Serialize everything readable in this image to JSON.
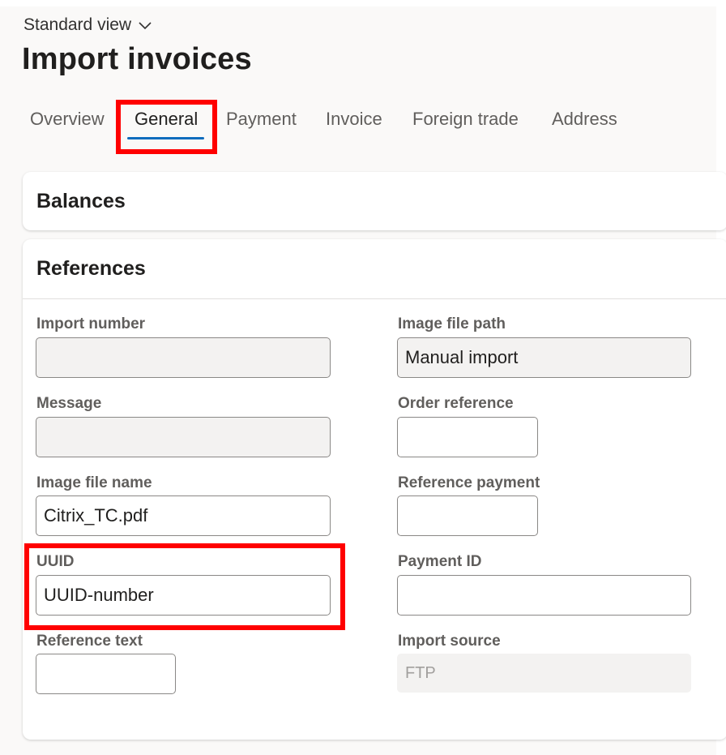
{
  "header": {
    "view_selector": "Standard view",
    "title": "Import invoices"
  },
  "tabs": [
    {
      "label": "Overview"
    },
    {
      "label": "General",
      "active": true
    },
    {
      "label": "Payment"
    },
    {
      "label": "Invoice"
    },
    {
      "label": "Foreign trade"
    },
    {
      "label": "Address"
    }
  ],
  "sections": {
    "balances": {
      "title": "Balances"
    },
    "references": {
      "title": "References",
      "fields": {
        "import_number": {
          "label": "Import number",
          "value": ""
        },
        "image_file_path": {
          "label": "Image file path",
          "value": "Manual import"
        },
        "message": {
          "label": "Message",
          "value": ""
        },
        "order_reference": {
          "label": "Order reference",
          "value": ""
        },
        "image_file_name": {
          "label": "Image file name",
          "value": "Citrix_TC.pdf"
        },
        "reference_payment": {
          "label": "Reference payment",
          "value": ""
        },
        "uuid": {
          "label": "UUID",
          "value": "UUID-number"
        },
        "payment_id": {
          "label": "Payment ID",
          "value": ""
        },
        "reference_text": {
          "label": "Reference text",
          "value": ""
        },
        "import_source": {
          "label": "Import source",
          "value": "FTP"
        }
      }
    }
  },
  "colors": {
    "highlight": "#ff0000",
    "tab_active_underline": "#0f6cbd",
    "readonly_field_bg": "#f3f2f1"
  },
  "icons": {
    "view_selector": "chevron-down-icon"
  }
}
